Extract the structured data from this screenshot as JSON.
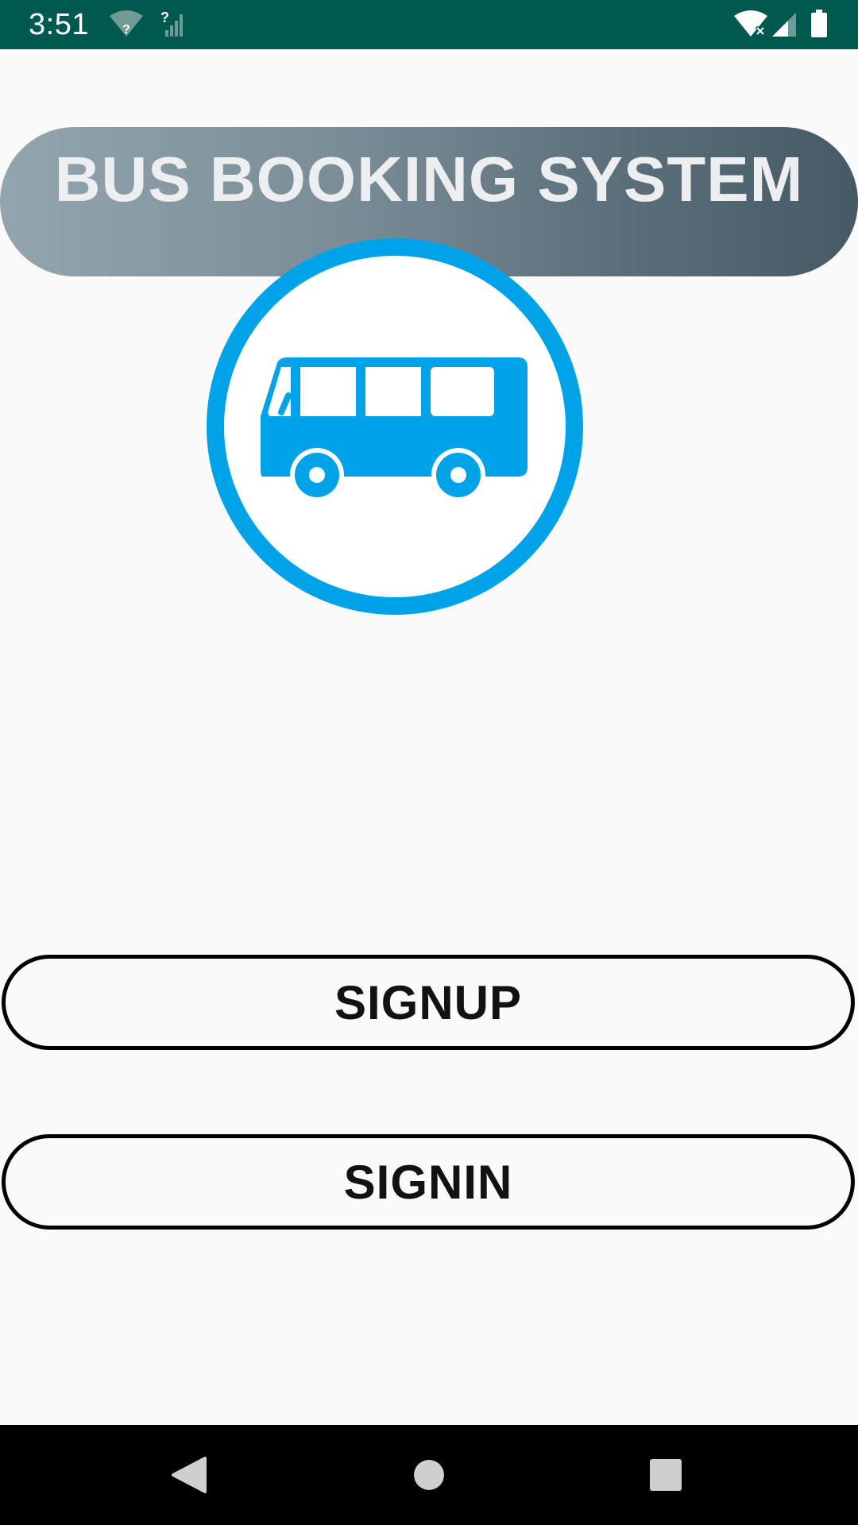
{
  "status_bar": {
    "time": "3:51",
    "icons": [
      "wifi-question-icon",
      "signal-question-icon",
      "wifi-x-icon",
      "signal-icon",
      "battery-icon"
    ]
  },
  "header": {
    "title": "BUS BOOKING SYSTEM"
  },
  "logo": {
    "icon": "bus-icon",
    "color": "#00a3e8"
  },
  "buttons": {
    "signup_label": "SIGNUP",
    "signin_label": "SIGNIN"
  },
  "nav_bar": {
    "icons": [
      "back-icon",
      "home-icon",
      "recents-icon"
    ]
  },
  "colors": {
    "status_bar": "#00594e",
    "title_gradient_start": "#93a5ae",
    "title_gradient_end": "#455a64",
    "background": "#fafafa",
    "accent": "#00a3e8"
  }
}
